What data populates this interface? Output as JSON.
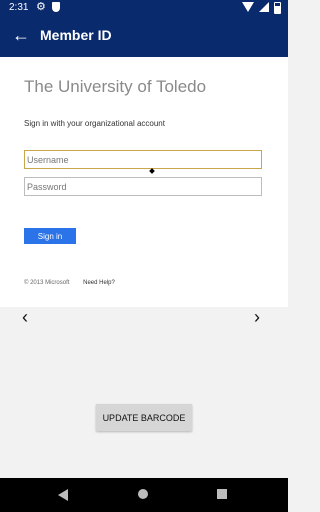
{
  "status": {
    "time": "2:31",
    "icons": [
      "gear-icon",
      "shield-icon",
      "wifi-icon",
      "cell-signal-icon",
      "battery-icon"
    ]
  },
  "appbar": {
    "title": "Member ID",
    "back_icon": "←"
  },
  "web": {
    "org_name": "The University of Toledo",
    "subtitle": "Sign in with your organizational account",
    "username_placeholder": "Username",
    "password_placeholder": "Password",
    "sign_in_label": "Sign in",
    "footer_copyright": "© 2013 Microsoft",
    "footer_help": "Need Help?"
  },
  "pager": {
    "left": "‹",
    "right": "›"
  },
  "update_button": "UPDATE BARCODE"
}
